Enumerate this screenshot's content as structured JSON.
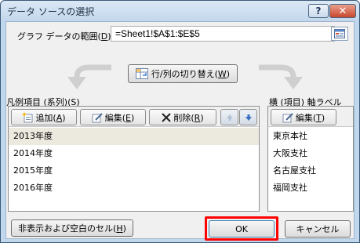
{
  "window": {
    "title": "データ ソースの選択",
    "help_glyph": "?",
    "close_glyph": "✕"
  },
  "range": {
    "label_prefix": "グラフ データの範囲(",
    "label_key": "D",
    "label_suffix": "):",
    "value": "=Sheet1!$A$1:$E$5"
  },
  "switch": {
    "label_prefix": "行/列の切り替え(",
    "label_key": "W",
    "label_suffix": ")"
  },
  "series": {
    "header_prefix": "凡例項目 (系列)(",
    "header_key": "S",
    "header_suffix": ")",
    "add": {
      "prefix": "追加(",
      "key": "A",
      "suffix": ")"
    },
    "edit": {
      "prefix": "編集(",
      "key": "E",
      "suffix": ")"
    },
    "delete": {
      "prefix": "削除(",
      "key": "R",
      "suffix": ")"
    },
    "items": [
      "2013年度",
      "2014年度",
      "2015年度",
      "2016年度"
    ]
  },
  "axis": {
    "header_prefix": "横 (項目) 軸ラベル(",
    "header_key": "C",
    "header_suffix": ")",
    "edit": {
      "prefix": "編集(",
      "key": "T",
      "suffix": ")"
    },
    "items": [
      "東京本社",
      "大阪支社",
      "名古屋支社",
      "福岡支社"
    ]
  },
  "buttons": {
    "hidden_prefix": "非表示および空白のセル(",
    "hidden_key": "H",
    "hidden_suffix": ")",
    "ok": "OK",
    "cancel": "キャンセル"
  },
  "colors": {
    "highlight": "#ff0000",
    "selected_row": "#eceadf",
    "title_bar": "#c3d7ec"
  },
  "icons": [
    "help-icon",
    "close-icon",
    "collapse-dialog-icon",
    "switch-row-column-icon",
    "add-series-icon",
    "edit-icon",
    "delete-icon",
    "move-up-icon",
    "move-down-icon"
  ]
}
